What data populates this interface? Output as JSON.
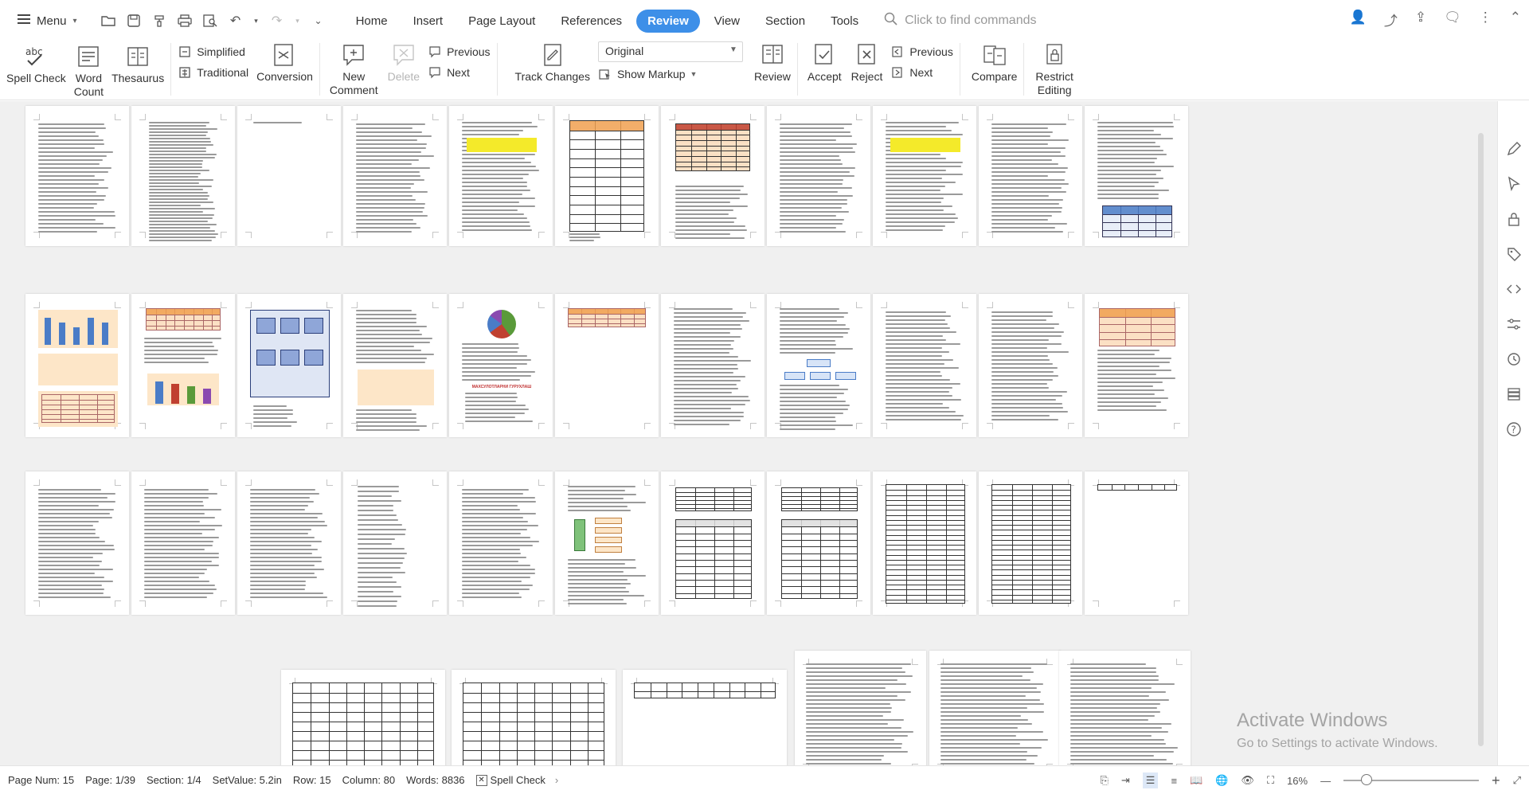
{
  "menu": {
    "label": "Menu"
  },
  "tabs": [
    "Home",
    "Insert",
    "Page Layout",
    "References",
    "Review",
    "View",
    "Section",
    "Tools"
  ],
  "active_tab": "Review",
  "search": {
    "placeholder": "Click to find commands"
  },
  "ribbon": {
    "spell_check": "Spell Check",
    "word_count_1": "Word",
    "word_count_2": "Count",
    "thesaurus": "Thesaurus",
    "simplified": "Simplified",
    "traditional": "Traditional",
    "conversion": "Conversion",
    "new_comment_1": "New",
    "new_comment_2": "Comment",
    "delete": "Delete",
    "previous_comment": "Previous",
    "next_comment": "Next",
    "track_changes": "Track Changes",
    "markup_value": "Original",
    "show_markup": "Show Markup",
    "review": "Review",
    "accept": "Accept",
    "reject": "Reject",
    "previous_change": "Previous",
    "next_change": "Next",
    "compare": "Compare",
    "restrict_1": "Restrict",
    "restrict_2": "Editing"
  },
  "watermark": {
    "line1": "Activate Windows",
    "line2": "Go to Settings to activate Windows."
  },
  "status": {
    "page_num": "Page Num: 15",
    "page": "Page: 1/39",
    "section": "Section: 1/4",
    "setvalue": "SetValue: 5.2in",
    "row": "Row: 15",
    "column": "Column: 80",
    "words": "Words: 8836",
    "spell_check": "Spell Check",
    "zoom": "16%"
  },
  "colors": {
    "accent": "#3d8fe8",
    "table_orange": "#f0a050",
    "table_orange_light": "#fbe0c4",
    "chart_blue": "#4a7cc7",
    "highlight": "#f4ea2a"
  },
  "pages_text": {
    "chart_heading": "МАХСУЛОТЛАРНИ ГУРУХЛАШ"
  }
}
